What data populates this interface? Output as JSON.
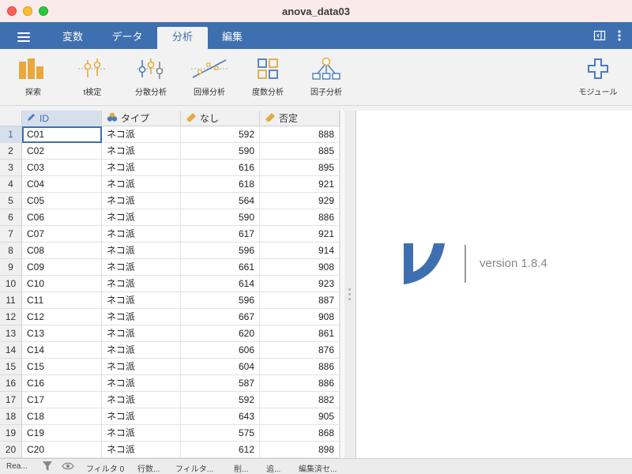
{
  "window": {
    "title": "anova_data03"
  },
  "menu": {
    "tabs": [
      {
        "label": "変数"
      },
      {
        "label": "データ"
      },
      {
        "label": "分析"
      },
      {
        "label": "編集"
      }
    ],
    "active_tab": "分析"
  },
  "ribbon": {
    "items": [
      {
        "label": "探索",
        "icon": "bar-chart-icon"
      },
      {
        "label": "t検定",
        "icon": "t-test-icon"
      },
      {
        "label": "分散分析",
        "icon": "anova-icon"
      },
      {
        "label": "回帰分析",
        "icon": "regression-icon"
      },
      {
        "label": "度数分析",
        "icon": "frequencies-icon"
      },
      {
        "label": "因子分析",
        "icon": "factor-icon"
      }
    ],
    "modules_label": "モジュール"
  },
  "table": {
    "columns": [
      {
        "label": "ID",
        "type": "nominal-text"
      },
      {
        "label": "タイプ",
        "type": "nominal"
      },
      {
        "label": "なし",
        "type": "continuous"
      },
      {
        "label": "否定",
        "type": "continuous"
      }
    ],
    "rows": [
      {
        "n": "1",
        "id": "C01",
        "type": "ネコ派",
        "a": "592",
        "b": "888"
      },
      {
        "n": "2",
        "id": "C02",
        "type": "ネコ派",
        "a": "590",
        "b": "885"
      },
      {
        "n": "3",
        "id": "C03",
        "type": "ネコ派",
        "a": "616",
        "b": "895"
      },
      {
        "n": "4",
        "id": "C04",
        "type": "ネコ派",
        "a": "618",
        "b": "921"
      },
      {
        "n": "5",
        "id": "C05",
        "type": "ネコ派",
        "a": "564",
        "b": "929"
      },
      {
        "n": "6",
        "id": "C06",
        "type": "ネコ派",
        "a": "590",
        "b": "886"
      },
      {
        "n": "7",
        "id": "C07",
        "type": "ネコ派",
        "a": "617",
        "b": "921"
      },
      {
        "n": "8",
        "id": "C08",
        "type": "ネコ派",
        "a": "596",
        "b": "914"
      },
      {
        "n": "9",
        "id": "C09",
        "type": "ネコ派",
        "a": "661",
        "b": "908"
      },
      {
        "n": "10",
        "id": "C10",
        "type": "ネコ派",
        "a": "614",
        "b": "923"
      },
      {
        "n": "11",
        "id": "C11",
        "type": "ネコ派",
        "a": "596",
        "b": "887"
      },
      {
        "n": "12",
        "id": "C12",
        "type": "ネコ派",
        "a": "667",
        "b": "908"
      },
      {
        "n": "13",
        "id": "C13",
        "type": "ネコ派",
        "a": "620",
        "b": "861"
      },
      {
        "n": "14",
        "id": "C14",
        "type": "ネコ派",
        "a": "606",
        "b": "876"
      },
      {
        "n": "15",
        "id": "C15",
        "type": "ネコ派",
        "a": "604",
        "b": "886"
      },
      {
        "n": "16",
        "id": "C16",
        "type": "ネコ派",
        "a": "587",
        "b": "886"
      },
      {
        "n": "17",
        "id": "C17",
        "type": "ネコ派",
        "a": "592",
        "b": "882"
      },
      {
        "n": "18",
        "id": "C18",
        "type": "ネコ派",
        "a": "643",
        "b": "905"
      },
      {
        "n": "19",
        "id": "C19",
        "type": "ネコ派",
        "a": "575",
        "b": "868"
      },
      {
        "n": "20",
        "id": "C20",
        "type": "ネコ派",
        "a": "612",
        "b": "898"
      }
    ]
  },
  "results": {
    "version_text": "version 1.8.4"
  },
  "status": {
    "ready": "Rea...",
    "filter": "フィルタ 0",
    "rows": "行数...",
    "filtered": "フィルタ...",
    "deleted": "削...",
    "added": "追...",
    "edited": "編集済セ..."
  },
  "colors": {
    "accent": "#3e6fb0",
    "ribbon_icon": "#e8a83c"
  }
}
